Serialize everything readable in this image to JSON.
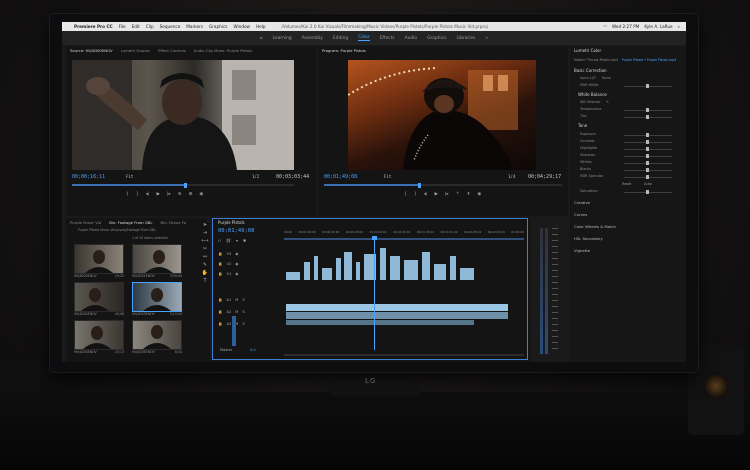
{
  "menubar": {
    "app": "Premiere Pro CC",
    "items": [
      "File",
      "Edit",
      "Clip",
      "Sequence",
      "Markers",
      "Graphics",
      "Window",
      "Help"
    ],
    "title": "/Volumes/Kai 2.0 Kai Vizuals/Filmmaking/Music Videos/Purple Pistols/Purple Pistols Music Vid.prproj",
    "clock": "Wed 2:27 PM",
    "user": "Kyle A. LaRue"
  },
  "workspaces": {
    "items": [
      "Learning",
      "Assembly",
      "Editing",
      "Color",
      "Effects",
      "Audio",
      "Graphics",
      "Libraries"
    ],
    "active": "Color"
  },
  "source_monitor": {
    "tabs": [
      "Source: 9VJ4D00ENOV",
      "Lumetri Scopes",
      "Effect Controls",
      "Audio Clip Mixer: Purple Pistols"
    ],
    "timecode_in": "00;00;16;11",
    "fit": "Fit",
    "scale": "1/2",
    "timecode_out": "00;03;03;44"
  },
  "program_monitor": {
    "title": "Program: Purple Pistols",
    "timecode_in": "00;01;49;08",
    "fit": "Fit",
    "scale": "1/4",
    "timecode_out": "00;04;29;17"
  },
  "lumetri": {
    "title": "Lumetri Color",
    "master": "Master * Purple Pistols.mp4",
    "clip": "Purple Pistols * Purple Pistols.mp4",
    "basic": "Basic Correction",
    "input_lut": "Input LUT",
    "input_lut_val": "None",
    "hdr_white": "HDR White",
    "white_balance": "White Balance",
    "wb_selector": "WB Selector",
    "temperature": "Temperature",
    "tint": "Tint",
    "tone": "Tone",
    "exposure": "Exposure",
    "contrast": "Contrast",
    "highlights": "Highlights",
    "shadows": "Shadows",
    "whites": "Whites",
    "blacks": "Blacks",
    "hdr_specular": "HDR Specular",
    "reset": "Reset",
    "auto": "Auto",
    "saturation": "Saturation",
    "creative": "Creative",
    "curves": "Curves",
    "color_wheels": "Color Wheels & Match",
    "hsl": "HSL Secondary",
    "vignette": "Vignette"
  },
  "project": {
    "tabs": [
      "Purple Music Vid",
      "Bin: Footage From GBL",
      "Bin: Drone Fo"
    ],
    "path": "Purple Pistols Music Vid.prproj\\Footage From GBL",
    "count": "1 of 15 items selected",
    "clips": [
      {
        "name": "9VJ4D00ENOV",
        "dur": "19;22"
      },
      {
        "name": "9VJ4D01ENOV",
        "dur": "3;30;44"
      },
      {
        "name": "9VJ4D02ENOV",
        "dur": "40;06"
      },
      {
        "name": "9VJ4D03ENOV",
        "dur": "5;10;44"
      },
      {
        "name": "9VJ4D04ENOV",
        "dur": "23;13"
      },
      {
        "name": "9VJ4D05ENOV",
        "dur": "8;44"
      }
    ]
  },
  "timeline": {
    "title": "Purple Pistols",
    "timecode": "00;01;49;08",
    "ruler": [
      "00;00",
      "00;00;16;00",
      "00;00;32;00",
      "00;00;48;00",
      "00;01;04;02",
      "00;01;20;02",
      "00;01;36;02",
      "00;01;52;02",
      "00;02;08;04",
      "00;02;24;04",
      "00;02;40"
    ],
    "tracks": [
      "V3",
      "V2",
      "V1",
      "A1",
      "A2",
      "A3"
    ],
    "master": "Master",
    "master_val": "0.0"
  },
  "colors": {
    "accent": "#4aa3ff",
    "video_clip": "#8fb9d6",
    "panel": "#141415"
  }
}
